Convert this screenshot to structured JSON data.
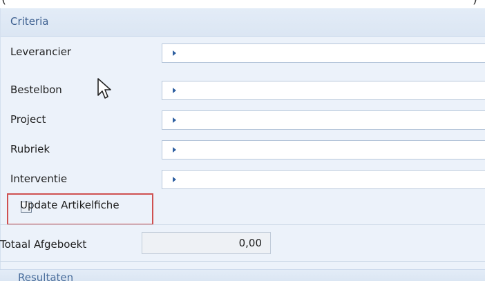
{
  "top_fragment": {
    "left_glyph": "(",
    "right_glyph": ")"
  },
  "criteria": {
    "title": "Criteria",
    "fields": [
      {
        "label": "Leverancier",
        "value": ""
      },
      {
        "label": "Bestelbon",
        "value": ""
      },
      {
        "label": "Project",
        "value": ""
      },
      {
        "label": "Rubriek",
        "value": ""
      },
      {
        "label": "Interventie",
        "value": ""
      }
    ],
    "update_checkbox": {
      "label": "Update Artikelfiche",
      "checked": false
    }
  },
  "totals": {
    "label": "Totaal Afgeboekt",
    "value": "0,00"
  },
  "results": {
    "title": "Resultaten"
  },
  "colors": {
    "highlight_border": "#cf5050",
    "header_text": "#3c5f8f",
    "panel_bg": "#ecf2fa"
  }
}
